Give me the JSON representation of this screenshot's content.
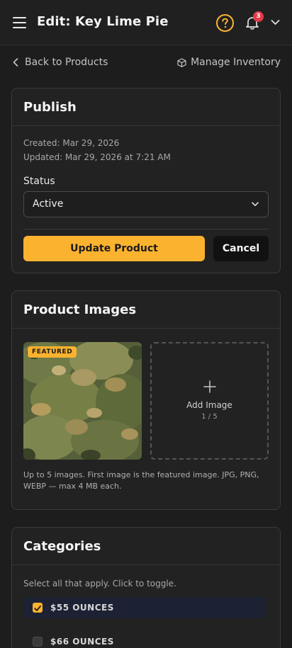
{
  "header": {
    "title": "Edit: Key Lime Pie",
    "help_icon": "help-circle-icon",
    "notification_count": "3",
    "accent_color": "#fbb32f"
  },
  "subnav": {
    "back_label": "Back to Products",
    "inventory_label": "Manage Inventory"
  },
  "publish": {
    "title": "Publish",
    "created": "Created: Mar 29, 2026",
    "updated": "Updated: Mar 29, 2026 at 7:21 AM",
    "status_label": "Status",
    "status_value": "Active",
    "update_button": "Update Product",
    "cancel_button": "Cancel"
  },
  "images": {
    "title": "Product Images",
    "featured_tag": "FEATURED",
    "add_label": "Add Image",
    "add_count": "1 / 5",
    "note": "Up to 5 images. First image is the featured image. JPG, PNG, WEBP — max 4 MB each."
  },
  "categories": {
    "title": "Categories",
    "hint": "Select all that apply. Click to toggle.",
    "items": [
      {
        "label": "$55 OUNCES",
        "checked": true
      },
      {
        "label": "$66 OUNCES",
        "checked": false
      }
    ]
  }
}
